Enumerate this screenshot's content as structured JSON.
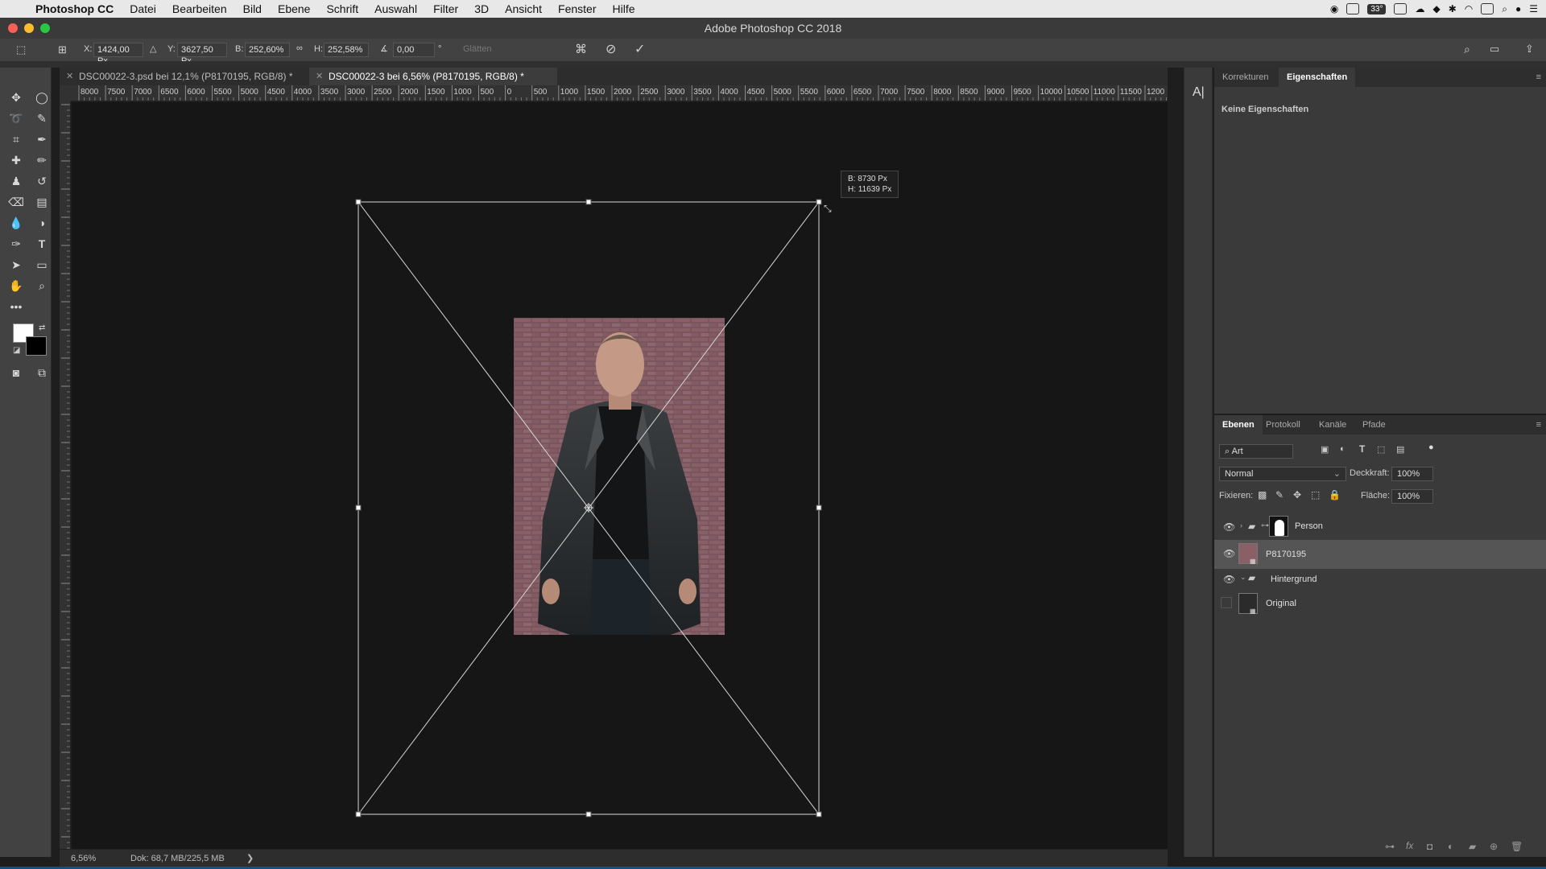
{
  "menubar": {
    "apple_icon": "apple-icon",
    "app_name": "Photoshop CC",
    "items": [
      "Datei",
      "Bearbeiten",
      "Bild",
      "Ebene",
      "Schrift",
      "Auswahl",
      "Filter",
      "3D",
      "Ansicht",
      "Fenster",
      "Hilfe"
    ],
    "temperature": "33°"
  },
  "window": {
    "title": "Adobe Photoshop CC 2018"
  },
  "options": {
    "x_label": "X:",
    "x_value": "1424,00 Px",
    "y_label": "Y:",
    "y_value": "3627,50 Px",
    "w_label": "B:",
    "w_value": "252,60%",
    "h_label": "H:",
    "h_value": "252,58%",
    "angle_value": "0,00",
    "angle_unit": "°",
    "smooth_label": "Glätten"
  },
  "tabs": [
    {
      "label": "DSC00022-3.psd bei 12,1% (P8170195, RGB/8) *",
      "active": false
    },
    {
      "label": "DSC00022-3 bei 6,56% (P8170195, RGB/8) *",
      "active": true
    }
  ],
  "ruler_h_labels": [
    "8000",
    "7500",
    "7000",
    "6500",
    "6000",
    "5500",
    "5000",
    "4500",
    "4000",
    "3500",
    "3000",
    "2500",
    "2000",
    "1500",
    "1000",
    "500",
    "0",
    "500",
    "1000",
    "1500",
    "2000",
    "2500",
    "3000",
    "3500",
    "4000",
    "4500",
    "5000",
    "5500",
    "6000",
    "6500",
    "7000",
    "7500",
    "8000",
    "8500",
    "9000",
    "9500",
    "10000",
    "10500",
    "11000",
    "11500",
    "1200"
  ],
  "transform_tooltip": {
    "width": "B: 8730 Px",
    "height": "H: 11639 Px"
  },
  "statusbar": {
    "zoom": "6,56%",
    "doc": "Dok: 68,7 MB/225,5 MB",
    "arrow": "❯"
  },
  "properties_panel": {
    "tabs": [
      "Korrekturen",
      "Eigenschaften"
    ],
    "active_tab": "Eigenschaften",
    "content": "Keine Eigenschaften"
  },
  "layers_panel": {
    "tabs": [
      "Ebenen",
      "Protokoll",
      "Kanäle",
      "Pfade"
    ],
    "filter_label": "Art",
    "blend_mode": "Normal",
    "opacity_label": "Deckkraft:",
    "opacity_value": "100%",
    "lock_label": "Fixieren:",
    "fill_label": "Fläche:",
    "fill_value": "100%",
    "layers": [
      {
        "name": "Person",
        "type": "group",
        "visible": true,
        "selected": false
      },
      {
        "name": "P8170195",
        "type": "smart-object",
        "visible": true,
        "selected": true
      },
      {
        "name": "Hintergrund",
        "type": "group",
        "visible": true,
        "selected": false
      },
      {
        "name": "Original",
        "type": "smart-object",
        "visible": false,
        "selected": false
      }
    ]
  },
  "colors": {
    "accent": "#1b4f7a",
    "canvas": "#161616",
    "panel": "#3a3a3a"
  }
}
